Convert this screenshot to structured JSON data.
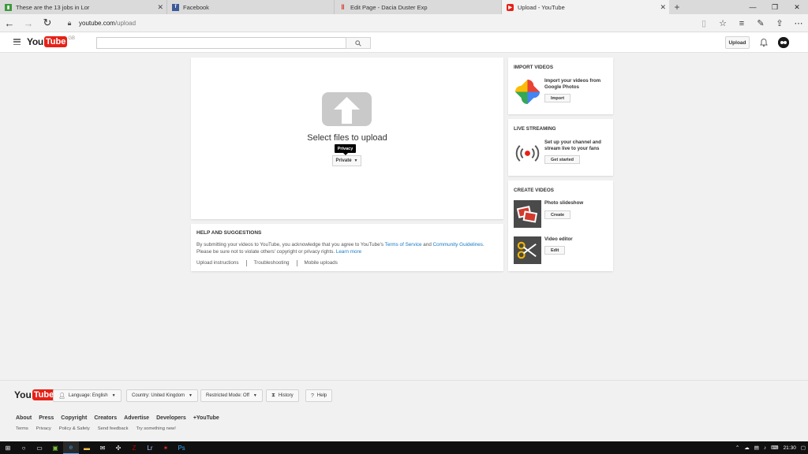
{
  "browser": {
    "tabs": [
      {
        "title": "These are the 13 jobs in Lor",
        "favicon": "document-icon",
        "color": "#3c9a3c",
        "active": false
      },
      {
        "title": "Facebook",
        "favicon": "facebook-icon",
        "color": "#3b5998",
        "active": false
      },
      {
        "title": "Edit Page - Dacia Duster Exp",
        "favicon": "pause-bars-icon",
        "color": "#d9352b",
        "active": false
      },
      {
        "title": "Upload - YouTube",
        "favicon": "youtube-icon",
        "color": "#e62117",
        "active": true
      }
    ],
    "url_domain": "youtube.com",
    "url_path": "/upload"
  },
  "masthead": {
    "logo_you": "You",
    "logo_tube": "Tube",
    "logo_country": "GB",
    "search_placeholder": "",
    "upload_label": "Upload"
  },
  "upload": {
    "title": "Select files to upload",
    "tooltip": "Privacy",
    "privacy_value": "Private"
  },
  "help": {
    "title": "HELP AND SUGGESTIONS",
    "text_1": "By submitting your videos to YouTube, you acknowledge that you agree to YouTube's ",
    "tos_link": "Terms of Service",
    "text_and": " and ",
    "guidelines_link": "Community Guidelines",
    "text_2": ". Please be sure not to violate others' copyright or privacy rights. ",
    "learn_more": "Learn more",
    "links": [
      "Upload instructions",
      "Troubleshooting",
      "Mobile uploads"
    ]
  },
  "import": {
    "title": "IMPORT VIDEOS",
    "text": "Import your videos from Google Photos",
    "button": "Import"
  },
  "live": {
    "title": "LIVE STREAMING",
    "text": "Set up your channel and stream live to your fans",
    "button": "Get started"
  },
  "create": {
    "title": "CREATE VIDEOS",
    "slideshow_text": "Photo slideshow",
    "slideshow_button": "Create",
    "editor_text": "Video editor",
    "editor_button": "Edit"
  },
  "footer": {
    "language": "Language: English",
    "country": "Country: United Kingdom",
    "restricted": "Restricted Mode: Off",
    "history": "History",
    "help": "Help",
    "links_primary": [
      "About",
      "Press",
      "Copyright",
      "Creators",
      "Advertise",
      "Developers",
      "+YouTube"
    ],
    "links_secondary": [
      "Terms",
      "Privacy",
      "Policy & Safety",
      "Send feedback",
      "Try something new!"
    ]
  },
  "taskbar": {
    "clock": "21:30"
  },
  "colors": {
    "youtube_red": "#e62117",
    "link_blue": "#167ac6"
  }
}
